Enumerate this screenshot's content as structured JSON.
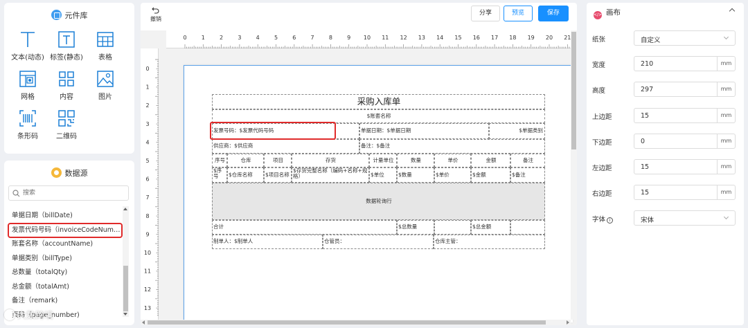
{
  "library": {
    "title": "元件库",
    "tools": [
      {
        "label": "文本(动态)",
        "icon": "text-dynamic-icon"
      },
      {
        "label": "标签(静态)",
        "icon": "label-static-icon"
      },
      {
        "label": "表格",
        "icon": "table-icon"
      },
      {
        "label": "网格",
        "icon": "grid-icon"
      },
      {
        "label": "内容",
        "icon": "content-icon"
      },
      {
        "label": "图片",
        "icon": "image-icon"
      },
      {
        "label": "条形码",
        "icon": "barcode-icon"
      },
      {
        "label": "二维码",
        "icon": "qrcode-icon"
      }
    ]
  },
  "datasource": {
    "title": "数据源",
    "search_placeholder": "搜索",
    "items": [
      "单据日期（billDate)",
      "发票代码号码（invoiceCodeNumber)",
      "账套名称（accountName)",
      "单据类别（billType)",
      "总数量（totalQty)",
      "总金额（totalAmt)",
      "备注（remark)",
      "页码（page_number)"
    ],
    "highlighted_index": 1
  },
  "toolbar": {
    "undo_label": "撤销",
    "share_label": "分享",
    "preview_label": "预览",
    "save_label": "保存"
  },
  "ruler": {
    "top": [
      "0",
      "1",
      "2",
      "3",
      "4",
      "5",
      "6",
      "7",
      "8",
      "9",
      "10",
      "11",
      "12",
      "13",
      "14",
      "15",
      "16",
      "17",
      "18",
      "19",
      "20",
      "21"
    ],
    "left": [
      "0",
      "1",
      "2",
      "3",
      "4",
      "5",
      "6",
      "7",
      "8",
      "9",
      "10",
      "11",
      "12",
      "13"
    ]
  },
  "report": {
    "title": "采购入库单",
    "account_name": "$账套名称",
    "invoice": "发票号码：$发票代码号码",
    "bill_date": "单据日期：$单据日期",
    "bill_type": "$单据类别",
    "supplier": "供应商：$供应商",
    "remark": "备注：$备注",
    "headers": [
      "序号",
      "仓库",
      "项目",
      "存货",
      "计量单位",
      "数量",
      "单价",
      "金额",
      "备注"
    ],
    "row": [
      "$序号",
      "$仓库名称",
      "$项目名称",
      "$存货完整名称（编码+名称+规格）",
      "$单位",
      "$数量",
      "$单价",
      "$金额",
      "$备注"
    ],
    "loop_text": "数据轮询行",
    "total_label": "合计",
    "total_qty": "$总数量",
    "total_amt": "$总金额",
    "maker": "制单人：$制单人",
    "keeper": "仓管员：",
    "manager": "仓库主管："
  },
  "canvas": {
    "title": "画布",
    "paper_label": "纸张",
    "paper_value": "自定义",
    "width_label": "宽度",
    "width_value": "210",
    "height_label": "高度",
    "height_value": "297",
    "top_label": "上边距",
    "top_value": "15",
    "bottom_label": "下边距",
    "bottom_value": "0",
    "left_label": "左边距",
    "left_value": "15",
    "right_label": "右边距",
    "right_value": "15",
    "font_label": "字体",
    "font_value": "宋体",
    "unit": "mm"
  },
  "watermark": "大数跨境"
}
